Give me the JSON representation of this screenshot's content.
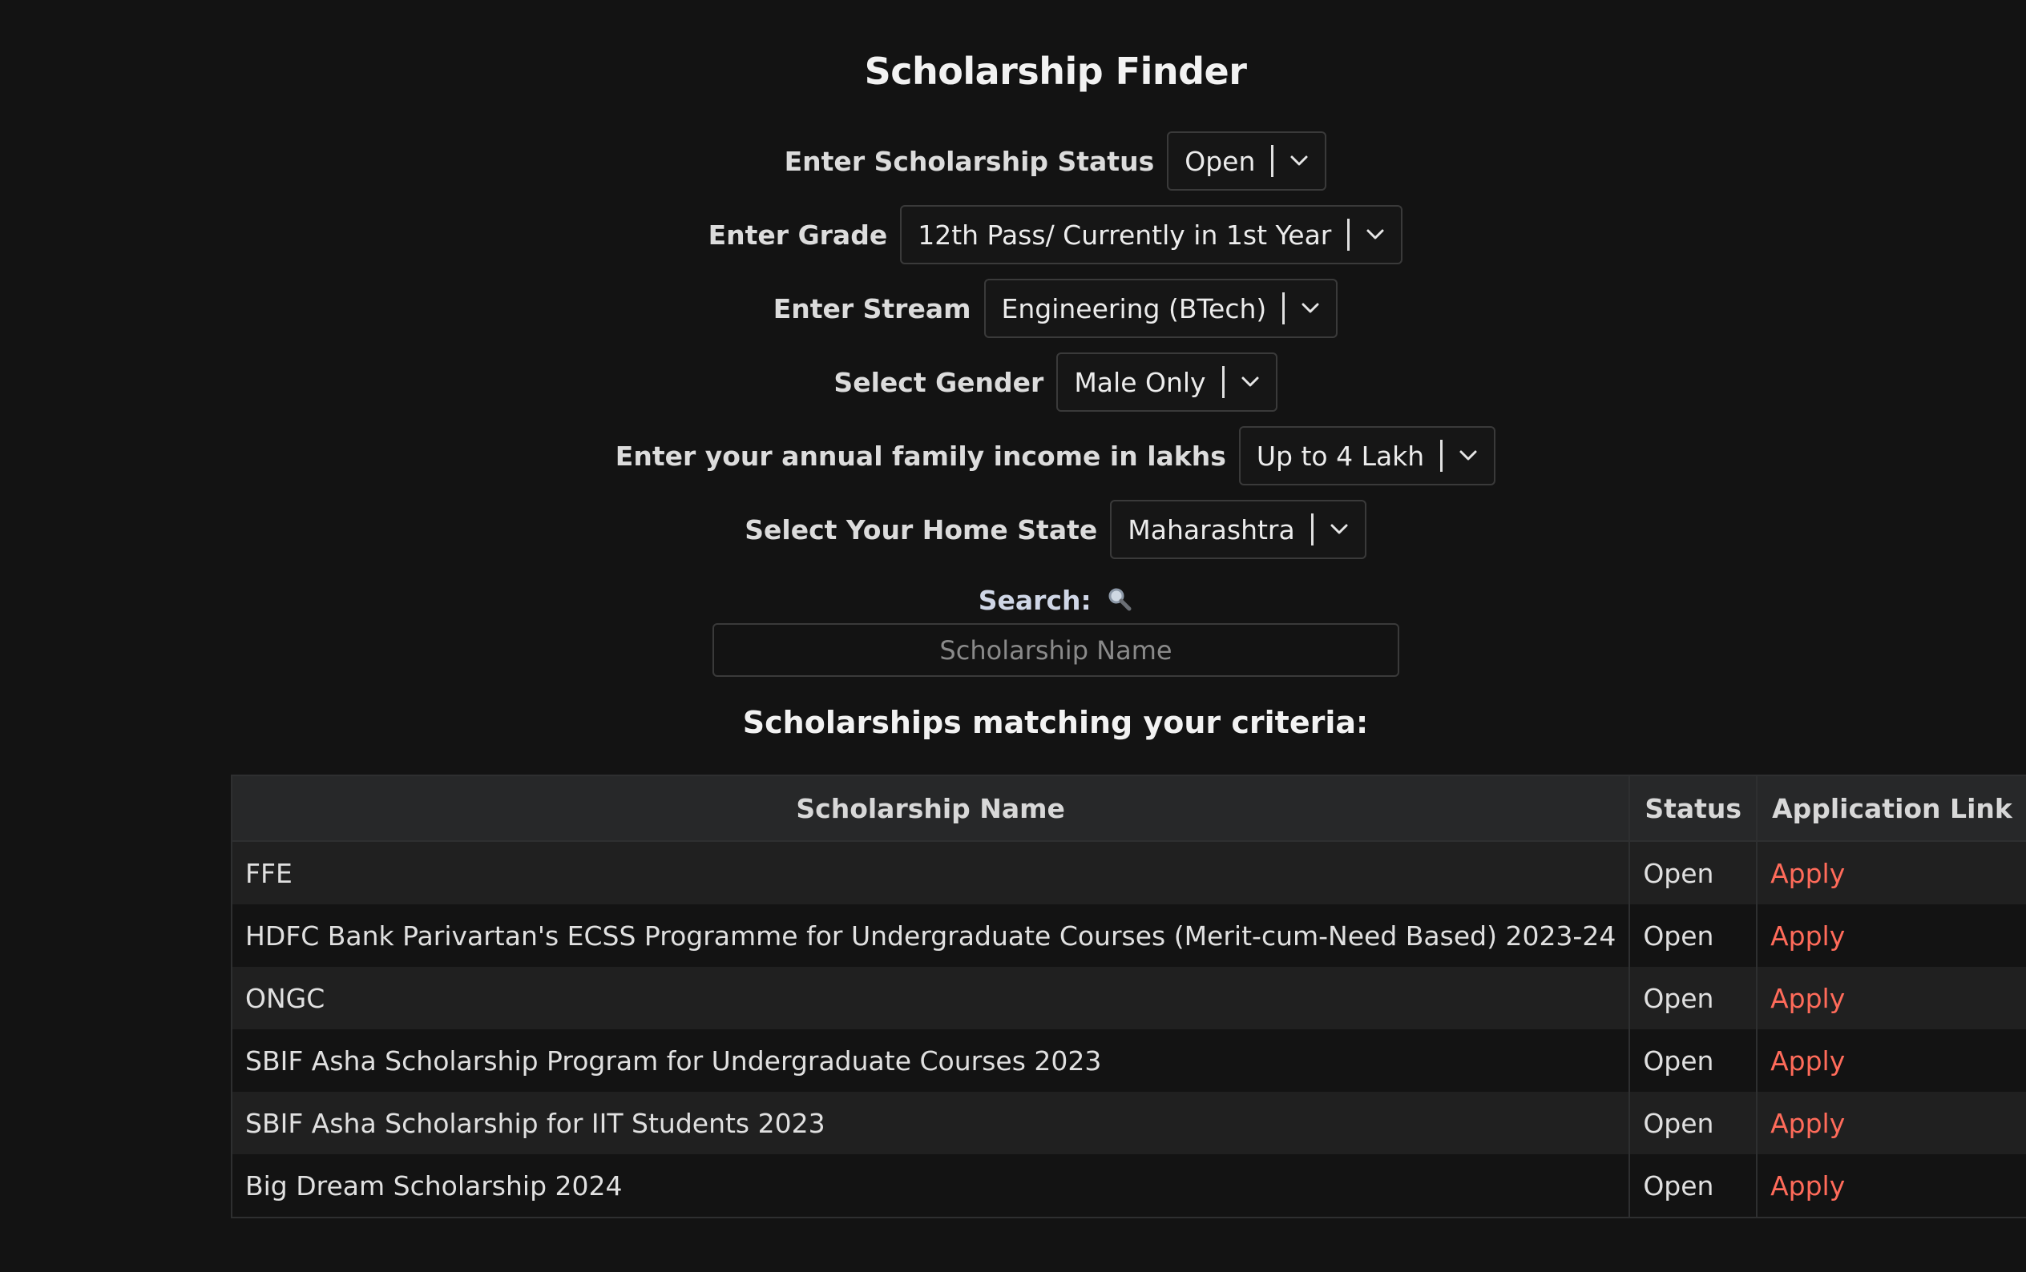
{
  "title": "Scholarship Finder",
  "filters": [
    {
      "label": "Enter Scholarship Status",
      "value": "Open"
    },
    {
      "label": "Enter Grade",
      "value": "12th Pass/ Currently in 1st Year"
    },
    {
      "label": "Enter Stream",
      "value": "Engineering (BTech)"
    },
    {
      "label": "Select Gender",
      "value": "Male Only"
    },
    {
      "label": "Enter your annual family income in lakhs",
      "value": "Up to 4 Lakh"
    },
    {
      "label": "Select Your Home State",
      "value": "Maharashtra"
    }
  ],
  "search": {
    "label": "Search:",
    "icon": "magnifying-glass-icon",
    "placeholder": "Scholarship Name",
    "value": ""
  },
  "results": {
    "heading": "Scholarships matching your criteria:",
    "columns": [
      "Scholarship Name",
      "Status",
      "Application Link"
    ],
    "rows": [
      {
        "name": "FFE",
        "status": "Open",
        "link": "Apply"
      },
      {
        "name": "HDFC Bank Parivartan's ECSS Programme for Undergraduate Courses (Merit-cum-Need Based) 2023-24",
        "status": "Open",
        "link": "Apply"
      },
      {
        "name": "ONGC",
        "status": "Open",
        "link": "Apply"
      },
      {
        "name": "SBIF Asha Scholarship Program for Undergraduate Courses 2023",
        "status": "Open",
        "link": "Apply"
      },
      {
        "name": "SBIF Asha Scholarship for IIT Students 2023",
        "status": "Open",
        "link": "Apply"
      },
      {
        "name": "Big Dream Scholarship 2024",
        "status": "Open",
        "link": "Apply"
      }
    ]
  },
  "colors": {
    "background": "#131313",
    "link": "#ff6b5a",
    "header_row": "#272829",
    "striped_row": "#202020"
  }
}
